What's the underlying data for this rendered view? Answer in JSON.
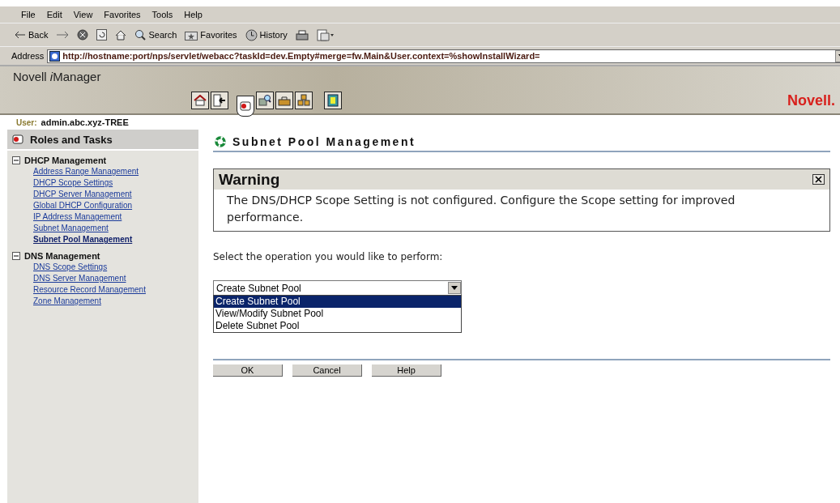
{
  "browser": {
    "menu": [
      "File",
      "Edit",
      "View",
      "Favorites",
      "Tools",
      "Help"
    ],
    "toolbar": [
      {
        "kind": "back",
        "label": "Back"
      },
      {
        "kind": "forward"
      },
      {
        "kind": "stop"
      },
      {
        "kind": "refresh"
      },
      {
        "kind": "home"
      },
      {
        "kind": "search",
        "label": "Search"
      },
      {
        "kind": "favorites",
        "label": "Favorites"
      },
      {
        "kind": "history",
        "label": "History"
      },
      {
        "kind": "print"
      },
      {
        "kind": "edit"
      }
    ],
    "address_label": "Address",
    "address": "http://hostname:port/nps/servlet/webacc?taskId=dev.Empty#merge=fw.Main&User.context=%showInstallWizard="
  },
  "header": {
    "product": [
      {
        "text": "Novell "
      },
      {
        "text": "i",
        "italic": true
      },
      {
        "text": "Manager"
      }
    ],
    "brand": "Novell.",
    "tools": [
      {
        "kind": "home",
        "selected": false
      },
      {
        "kind": "exit",
        "selected": false
      },
      {
        "kind": "roles",
        "selected": true
      },
      {
        "kind": "search",
        "selected": false
      },
      {
        "kind": "configure",
        "selected": false
      },
      {
        "kind": "objects",
        "selected": false
      },
      {
        "kind": "help",
        "selected": false
      }
    ],
    "user_label": "User:",
    "user": "admin.abc.xyz-TREE"
  },
  "sidebar": {
    "title": "Roles and Tasks",
    "groups": [
      {
        "name": "DHCP Management",
        "expanded": true,
        "items": [
          {
            "label": "Address Range Management",
            "selected": false
          },
          {
            "label": "DHCP Scope Settings",
            "selected": false
          },
          {
            "label": "DHCP Server Management",
            "selected": false
          },
          {
            "label": "Global DHCP Configuration",
            "selected": false
          },
          {
            "label": "IP Address Management",
            "selected": false
          },
          {
            "label": "Subnet Management",
            "selected": false
          },
          {
            "label": "Subnet Pool Management",
            "selected": true
          }
        ]
      },
      {
        "name": "DNS Management",
        "expanded": true,
        "items": [
          {
            "label": "DNS Scope Settings",
            "selected": false
          },
          {
            "label": "DNS Server Management",
            "selected": false
          },
          {
            "label": "Resource Record Management",
            "selected": false
          },
          {
            "label": "Zone Management",
            "selected": false
          }
        ]
      }
    ]
  },
  "main": {
    "title": "Subnet Pool Management",
    "warning": {
      "title": "Warning",
      "message": "The DNS/DHCP Scope Setting is not configured. Configure the Scope setting for improved performance."
    },
    "prompt": "Select the operation you would like to perform:",
    "operation": {
      "value": "Create Subnet Pool",
      "expanded": true,
      "options": [
        {
          "label": "Create Subnet Pool",
          "selected": true
        },
        {
          "label": "View/Modify Subnet Pool",
          "selected": false
        },
        {
          "label": "Delete Subnet Pool",
          "selected": false
        }
      ]
    },
    "buttons": [
      "OK",
      "Cancel",
      "Help"
    ]
  }
}
